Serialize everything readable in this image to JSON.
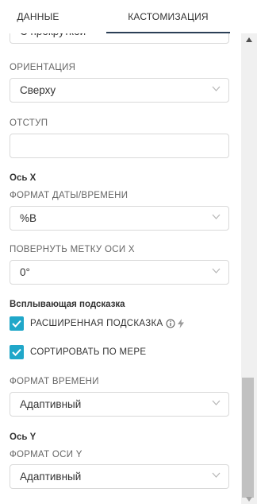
{
  "tabs": {
    "data_label": "ДАННЫЕ",
    "custom_label": "КАСТОМИЗАЦИЯ"
  },
  "fields": {
    "scroll_mode_value": "С прокруткой",
    "orientation_label": "ОРИЕНТАЦИЯ",
    "orientation_value": "Сверху",
    "padding_label": "ОТСТУП",
    "padding_value": "",
    "x_axis_section": "Ось X",
    "date_format_label": "ФОРМАТ ДАТЫ/ВРЕМЕНИ",
    "date_format_value": "%B",
    "rotate_label": "ПОВЕРНУТЬ МЕТКУ ОСИ X",
    "rotate_value": "0°",
    "tooltip_section": "Всплывающая подсказка",
    "rich_tooltip_label": "РАСШИРЕННАЯ ПОДСКАЗКА",
    "rich_tooltip_checked": true,
    "sort_by_metric_label": "СОРТИРОВАТЬ ПО МЕРЕ",
    "sort_by_metric_checked": true,
    "time_format_label": "ФОРМАТ ВРЕМЕНИ",
    "time_format_value": "Адаптивный",
    "y_axis_section": "Ось Y",
    "y_axis_format_label": "ФОРМАТ ОСИ Y",
    "y_axis_format_value": "Адаптивный"
  },
  "colors": {
    "accent": "#20a7c9",
    "tab_underline": "#2b3f56",
    "border": "#d9d9d9"
  },
  "icons": {
    "dropdown": "chevron-down-icon",
    "info": "info-icon",
    "lightning": "bolt-icon",
    "check": "check-icon"
  }
}
